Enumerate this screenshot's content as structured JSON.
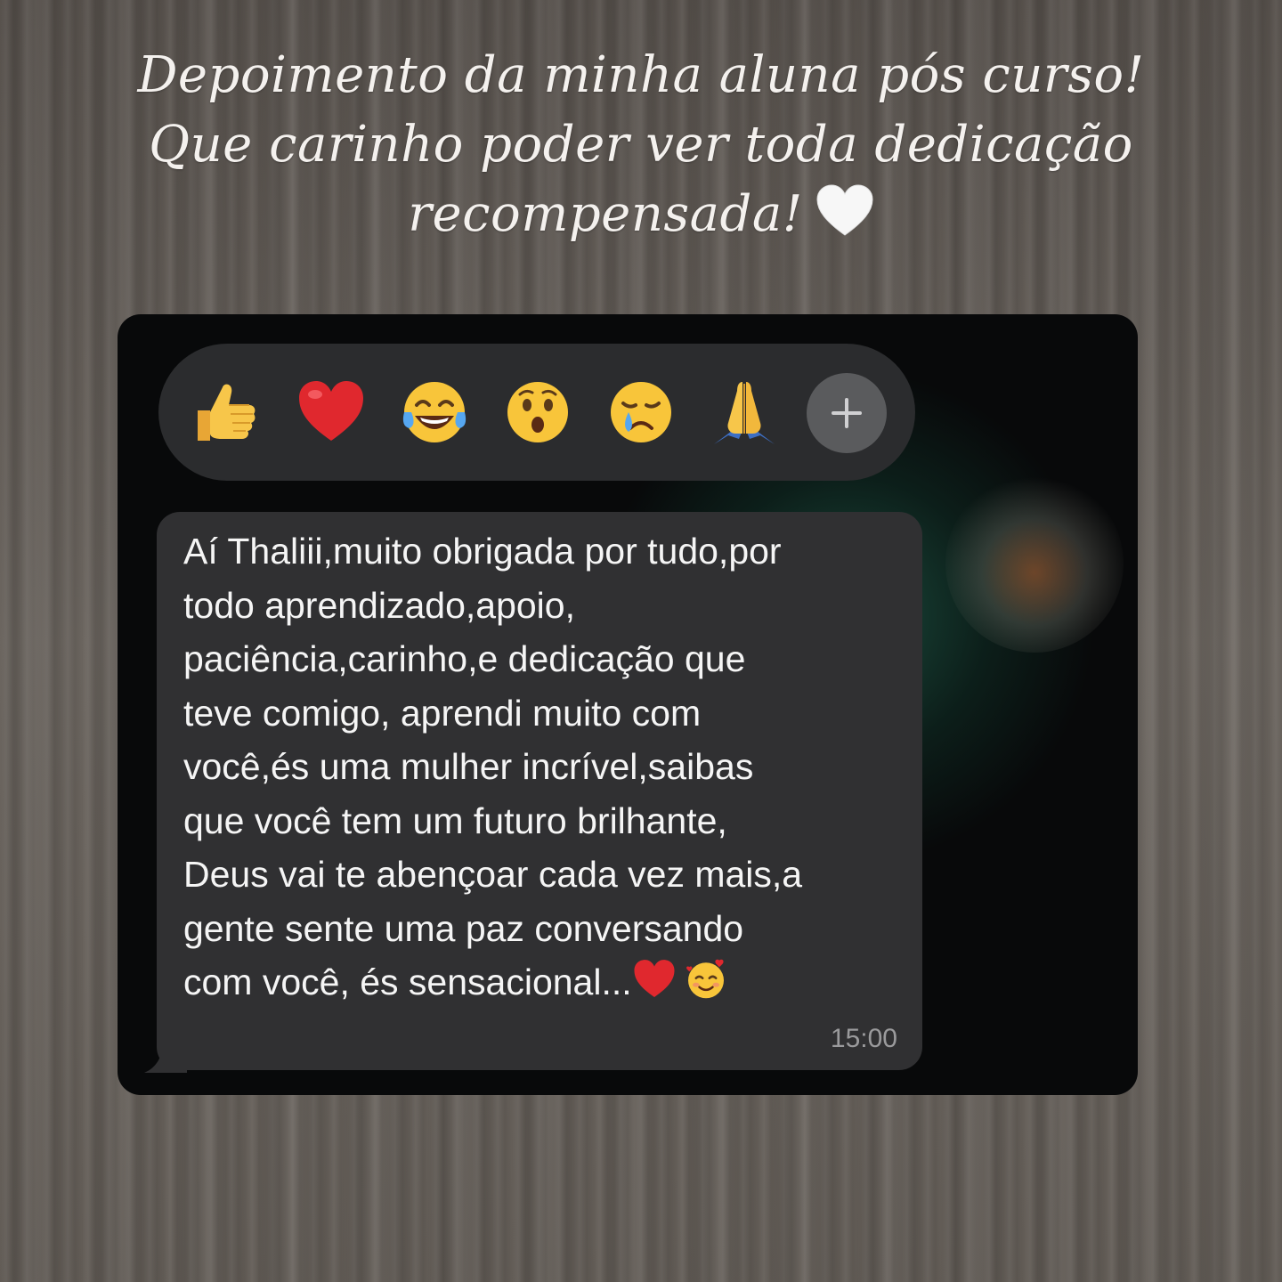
{
  "caption": {
    "line1": "Depoimento da minha aluna pós curso!",
    "line2": "Que carinho poder ver toda dedicação",
    "line3": "recompensada!",
    "emoji": "white-heart-icon"
  },
  "reactions": [
    {
      "icon": "thumbs-up-icon"
    },
    {
      "icon": "red-heart-icon"
    },
    {
      "icon": "tears-of-joy-icon"
    },
    {
      "icon": "surprised-face-icon"
    },
    {
      "icon": "crying-face-icon"
    },
    {
      "icon": "folded-hands-icon"
    },
    {
      "icon": "plus-icon"
    }
  ],
  "message": {
    "text": "Aí Thaliii,muito obrigada por tudo,por\ntodo aprendizado,apoio,\npaciência,carinho,e dedicação que\nteve comigo, aprendi muito com\nvocê,és uma mulher incrível,saibas\nque você tem um futuro brilhante,\nDeus vai te abençoar cada vez mais,a\ngente sente uma paz conversando\ncom você, és sensacional...",
    "trailing_emojis": [
      "red-heart-icon",
      "smiling-face-with-hearts-icon"
    ],
    "time": "15:00"
  },
  "colors": {
    "card_background": "#08090a",
    "reaction_bar": "#2b2c2e",
    "bubble": "#303032",
    "message_text": "#f5f5f5",
    "time_text": "#9a9a9c"
  }
}
